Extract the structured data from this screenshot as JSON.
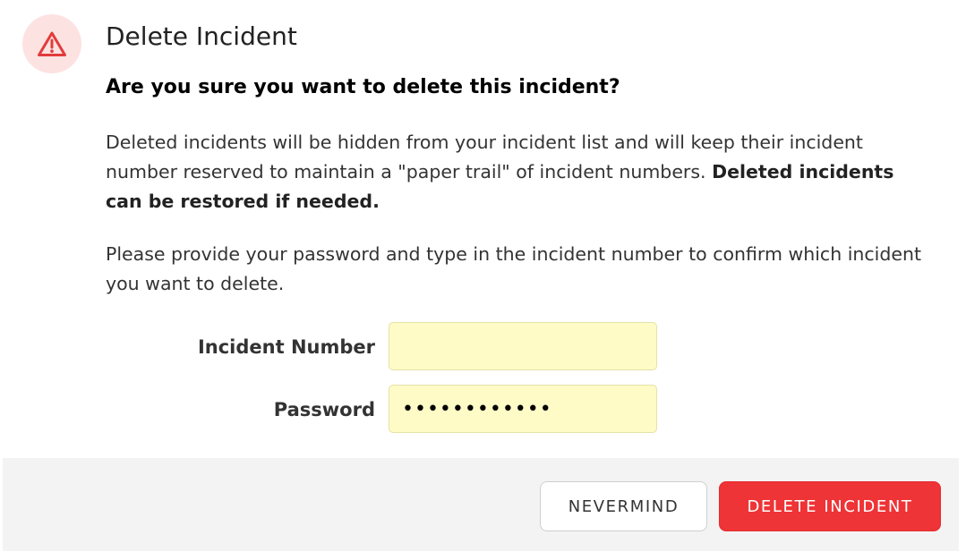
{
  "dialog": {
    "title": "Delete Incident",
    "icon": "warning-triangle-icon",
    "question": "Are you sure you want to delete this incident?",
    "paragraph1": {
      "text": "Deleted incidents will be hidden from your incident list and will keep their incident number reserved to maintain a \"paper trail\" of incident numbers. ",
      "bold": "Deleted incidents can be restored if needed."
    },
    "paragraph2": "Please provide your password and type in the incident number to confirm which incident you want to delete.",
    "fields": {
      "incident_number": {
        "label": "Incident Number",
        "value": ""
      },
      "password": {
        "label": "Password",
        "value": "••••••••••••"
      }
    },
    "buttons": {
      "cancel": "NEVERMIND",
      "delete": "DELETE INCIDENT"
    }
  },
  "colors": {
    "danger": "#ee3436",
    "danger_tint": "#fde2e2",
    "input_bg": "#fefbc6",
    "footer_bg": "#f3f3f3"
  }
}
